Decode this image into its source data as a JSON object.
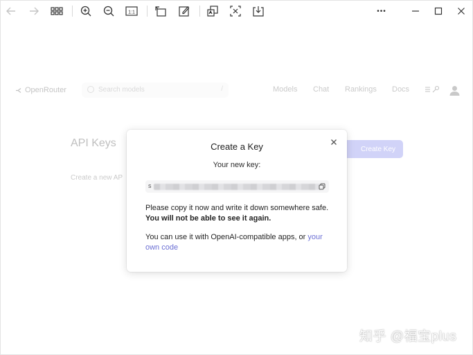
{
  "viewer": {
    "toolbar_icons": [
      "arrow-left-icon",
      "arrow-right-icon",
      "grid-icon",
      "zoom-in-icon",
      "zoom-out-icon",
      "actual-size-icon",
      "rotate-icon",
      "edit-icon",
      "copy-text-icon",
      "ocr-icon",
      "download-icon",
      "more-icon",
      "minimize-icon",
      "maximize-icon",
      "close-icon"
    ],
    "actual_size_label": "1:1",
    "more_label": "•••"
  },
  "site": {
    "brand": "OpenRouter",
    "search_placeholder": "Search models",
    "search_shortcut": "/",
    "nav": [
      "Models",
      "Chat",
      "Rankings",
      "Docs"
    ],
    "nav_icons": [
      "menu-icon",
      "key-icon"
    ]
  },
  "page": {
    "title": "API Keys",
    "subtitle": "Create a new AP",
    "create_button": "Create Key"
  },
  "dialog": {
    "title": "Create a Key",
    "close_label": "×",
    "key_label": "Your new key:",
    "key_first_char": "s",
    "instruction_plain": "Please copy it now and write it down somewhere safe. ",
    "instruction_bold": "You will not be able to see it again.",
    "usage_text": "You can use it with OpenAI-compatible apps, or ",
    "usage_link": "your own code"
  },
  "watermark": "知乎 @福宝plus",
  "colors": {
    "accent": "#6f74e9",
    "link": "#6b6fd4"
  }
}
